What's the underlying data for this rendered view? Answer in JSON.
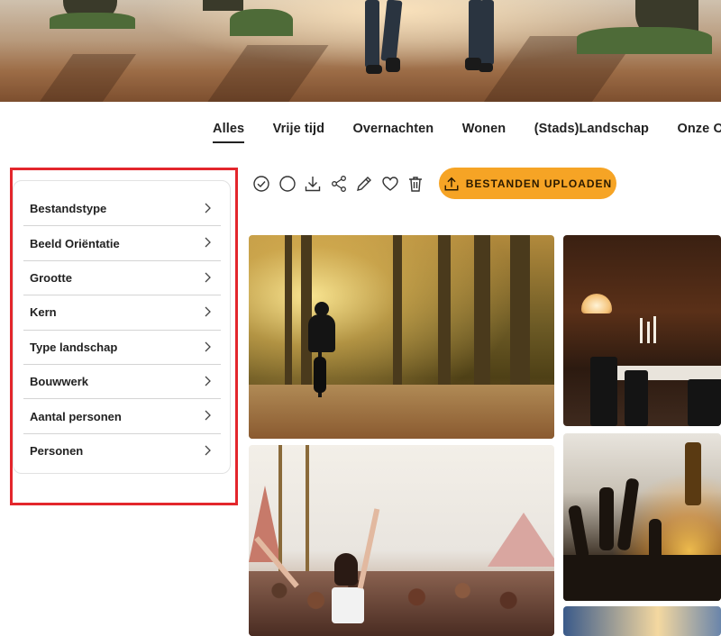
{
  "nav": {
    "tabs": [
      {
        "label": "Alles",
        "active": true
      },
      {
        "label": "Vrije tijd",
        "active": false
      },
      {
        "label": "Overnachten",
        "active": false
      },
      {
        "label": "Wonen",
        "active": false
      },
      {
        "label": "(Stads)Landschap",
        "active": false
      },
      {
        "label": "Onze Orga",
        "active": false
      }
    ]
  },
  "filters": {
    "items": [
      {
        "label": "Bestandstype"
      },
      {
        "label": "Beeld Oriëntatie"
      },
      {
        "label": "Grootte"
      },
      {
        "label": "Kern"
      },
      {
        "label": "Type landschap"
      },
      {
        "label": "Bouwwerk"
      },
      {
        "label": "Aantal personen"
      },
      {
        "label": "Personen"
      }
    ],
    "highlight_color": "#e3262c"
  },
  "toolbar": {
    "icons": [
      "check-circle-icon",
      "circle-icon",
      "download-icon",
      "share-icon",
      "pencil-icon",
      "heart-icon",
      "trash-icon"
    ],
    "upload_label": "BESTANDEN UPLOADEN",
    "upload_color": "#f6a425"
  },
  "colors": {
    "text": "#222222",
    "border": "#d4d4d4"
  }
}
